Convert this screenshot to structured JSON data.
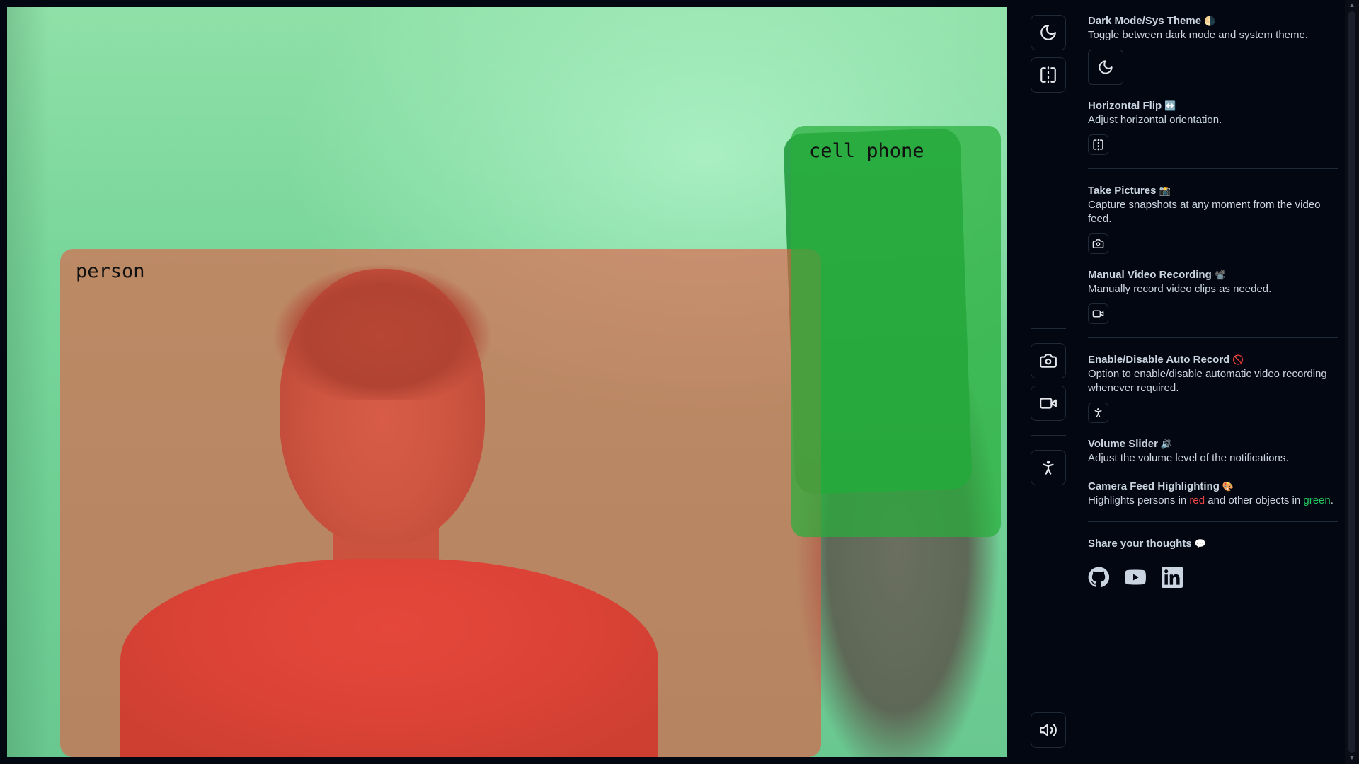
{
  "feed": {
    "detections": [
      {
        "label": "person",
        "color": "#e65a46"
      },
      {
        "label": "cell phone",
        "color": "#28af3c"
      }
    ]
  },
  "toolbar": {
    "buttons": [
      {
        "icon": "moon-icon"
      },
      {
        "icon": "flip-horizontal-icon"
      },
      {
        "icon": "camera-icon"
      },
      {
        "icon": "video-icon"
      },
      {
        "icon": "accessibility-icon"
      },
      {
        "icon": "volume-icon"
      }
    ]
  },
  "panel": {
    "dark_mode": {
      "title": "Dark Mode/Sys Theme",
      "emoji": "🌗",
      "desc": "Toggle between dark mode and system theme."
    },
    "flip": {
      "title": "Horizontal Flip",
      "emoji": "↔️",
      "desc": "Adjust horizontal orientation."
    },
    "pictures": {
      "title": "Take Pictures",
      "emoji": "📸",
      "desc": "Capture snapshots at any moment from the video feed."
    },
    "recording": {
      "title": "Manual Video Recording",
      "emoji": "📽️",
      "desc": "Manually record video clips as needed."
    },
    "auto_record": {
      "title": "Enable/Disable Auto Record",
      "emoji": "🚫",
      "desc": "Option to enable/disable automatic video recording whenever required."
    },
    "volume": {
      "title": "Volume Slider",
      "emoji": "🔊",
      "desc": "Adjust the volume level of the notifications."
    },
    "highlighting": {
      "title": "Camera Feed Highlighting",
      "emoji": "🎨",
      "desc_1": "Highlights persons in ",
      "red_word": "red",
      "desc_2": " and other objects in ",
      "green_word": "green",
      "desc_3": "."
    },
    "thoughts": {
      "title": "Share your thoughts",
      "emoji": "💬"
    },
    "socials": [
      {
        "icon": "github-icon"
      },
      {
        "icon": "youtube-icon"
      },
      {
        "icon": "linkedin-icon"
      }
    ]
  },
  "colors": {
    "background": "#030712",
    "text": "#cbd5e1",
    "border": "#1f2937",
    "red": "#ef4444",
    "green": "#22c55e"
  }
}
